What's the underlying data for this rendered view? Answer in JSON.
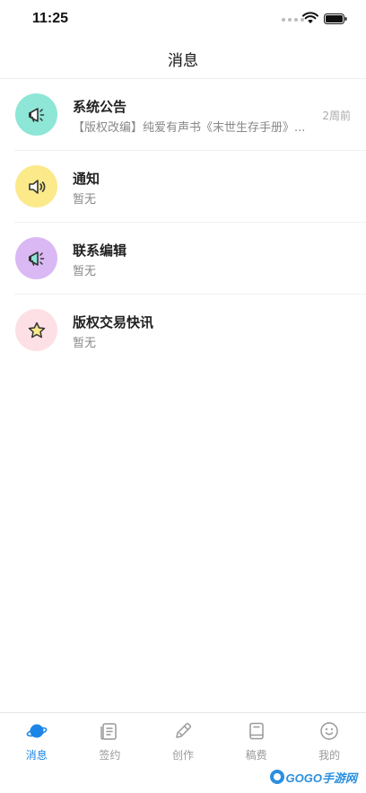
{
  "status_bar": {
    "time": "11:25"
  },
  "nav": {
    "title": "消息"
  },
  "messages": [
    {
      "title": "系统公告",
      "subtitle": "【版权改编】纯爱有声书《末世生存手册》...",
      "time": "2周前",
      "icon": "megaphone-icon",
      "color": "#8de6d6"
    },
    {
      "title": "通知",
      "subtitle": "暂无",
      "time": "",
      "icon": "speaker-icon",
      "color": "#fbe98a"
    },
    {
      "title": "联系编辑",
      "subtitle": "暂无",
      "time": "",
      "icon": "megaphone-icon",
      "color": "#d9b8f4"
    },
    {
      "title": "版权交易快讯",
      "subtitle": "暂无",
      "time": "",
      "icon": "star-icon",
      "color": "#fde0e6"
    }
  ],
  "tabs": [
    {
      "label": "消息",
      "icon": "planet-icon",
      "active": true
    },
    {
      "label": "签约",
      "icon": "contract-icon",
      "active": false
    },
    {
      "label": "创作",
      "icon": "pencil-icon",
      "active": false
    },
    {
      "label": "稿费",
      "icon": "book-icon",
      "active": false
    },
    {
      "label": "我的",
      "icon": "smiley-icon",
      "active": false
    }
  ],
  "watermark": {
    "text": "GOGO手游网"
  },
  "colors": {
    "accent": "#1c86e8",
    "inactive": "#999999"
  }
}
